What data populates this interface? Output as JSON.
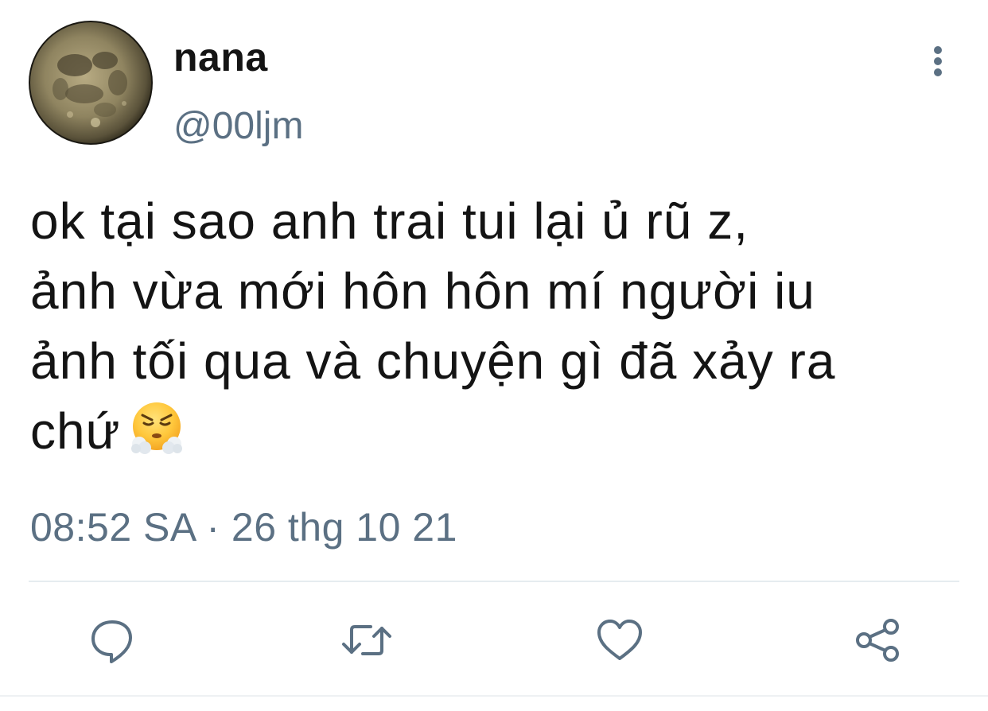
{
  "user": {
    "display_name": "nana",
    "handle": "@00ljm",
    "avatar_icon": "full-moon-avatar"
  },
  "tweet": {
    "lines": [
      "ok tại sao anh trai tui lại ủ rũ z,",
      "ảnh vừa mới hôn hôn mí người iu",
      "ảnh tối qua và chuyện gì đã xảy ra",
      "chứ"
    ],
    "emoji": "face-with-steam-from-nose",
    "timestamp": "08:52 SA · 26 thg 10 21"
  },
  "actions": {
    "reply_icon": "reply-icon",
    "retweet_icon": "retweet-icon",
    "like_icon": "heart-icon",
    "share_icon": "share-icon"
  },
  "colors": {
    "text": "#141414",
    "secondary": "#5b7083",
    "divider": "#e6ecf0"
  }
}
